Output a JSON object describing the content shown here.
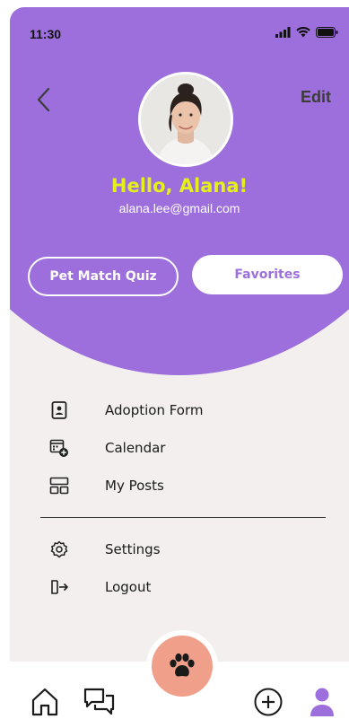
{
  "status_bar": {
    "time": "11:30"
  },
  "header": {
    "edit_label": "Edit",
    "greeting": "Hello, Alana!",
    "email": "alana.lee@gmail.com"
  },
  "actions": {
    "quiz_label": "Pet Match Quiz",
    "favorites_label": "Favorites"
  },
  "menu": {
    "items": [
      {
        "label": "Adoption Form",
        "icon": "form-icon"
      },
      {
        "label": "Calendar",
        "icon": "calendar-icon"
      },
      {
        "label": "My Posts",
        "icon": "posts-icon"
      }
    ],
    "secondary": [
      {
        "label": "Settings",
        "icon": "gear-icon"
      },
      {
        "label": "Logout",
        "icon": "logout-icon"
      }
    ]
  },
  "bottom_nav": {
    "items": [
      "home-icon",
      "chat-icon",
      "paw-icon",
      "add-icon",
      "profile-icon"
    ],
    "active": "profile-icon"
  },
  "colors": {
    "primary": "#9d6fdc",
    "greeting": "#e4f01a",
    "fab": "#f0a08a",
    "background": "#f3efef"
  }
}
